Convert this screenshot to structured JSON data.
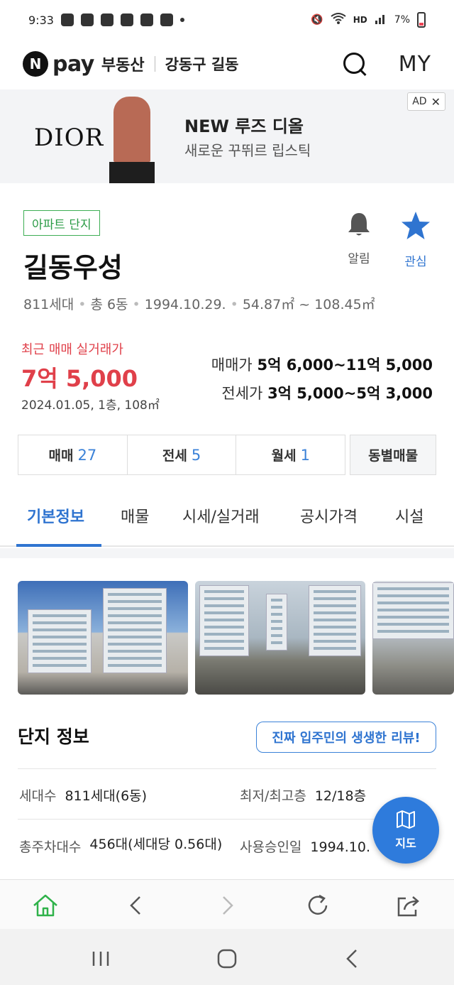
{
  "status_bar": {
    "time": "9:33",
    "battery": "7%",
    "network": "HD"
  },
  "header": {
    "logo_n": "N",
    "logo_pay": "pay",
    "service": "부동산",
    "location": "강동구 길동",
    "my_label": "MY"
  },
  "ad": {
    "brand": "DIOR",
    "lipstick_brand": "DIOR",
    "title": "NEW 루즈 디올",
    "subtitle": "새로운 꾸뛰르 립스틱",
    "tag": "AD",
    "close": "✕"
  },
  "complex": {
    "category": "아파트 단지",
    "name": "길동우성",
    "households": "811세대",
    "buildings": "총 6동",
    "approval_date": "1994.10.29.",
    "area_range": "54.87㎡ ~ 108.45㎡",
    "alarm_label": "알림",
    "favorite_label": "관심"
  },
  "price": {
    "recent_label": "최근 매매 실거래가",
    "recent_value": "7억 5,000",
    "recent_detail": "2024.01.05, 1층, 108㎡",
    "sale_label": "매매가",
    "sale_range": "5억 6,000~11억 5,000",
    "jeonse_label": "전세가",
    "jeonse_range": "3억 5,000~5억 3,000"
  },
  "deal_tabs": [
    {
      "label": "매매",
      "count": "27"
    },
    {
      "label": "전세",
      "count": "5"
    },
    {
      "label": "월세",
      "count": "1"
    },
    {
      "label": "동별매물",
      "count": ""
    }
  ],
  "content_tabs": [
    "기본정보",
    "매물",
    "시세/실거래",
    "공시가격",
    "시설"
  ],
  "info": {
    "title": "단지 정보",
    "review_button": "진짜 입주민의 생생한 리뷰!",
    "rows": [
      {
        "label": "세대수",
        "value": "811세대(6동)"
      },
      {
        "label": "최저/최고층",
        "value": "12/18층"
      },
      {
        "label": "총주차대수",
        "value": "456대(세대당 0.56대)"
      },
      {
        "label": "사용승인일",
        "value": "1994.10."
      }
    ]
  },
  "map_fab": {
    "label": "지도"
  },
  "colors": {
    "accent": "#2f74d0",
    "price_red": "#e0404a",
    "badge_green": "#3dae54"
  }
}
